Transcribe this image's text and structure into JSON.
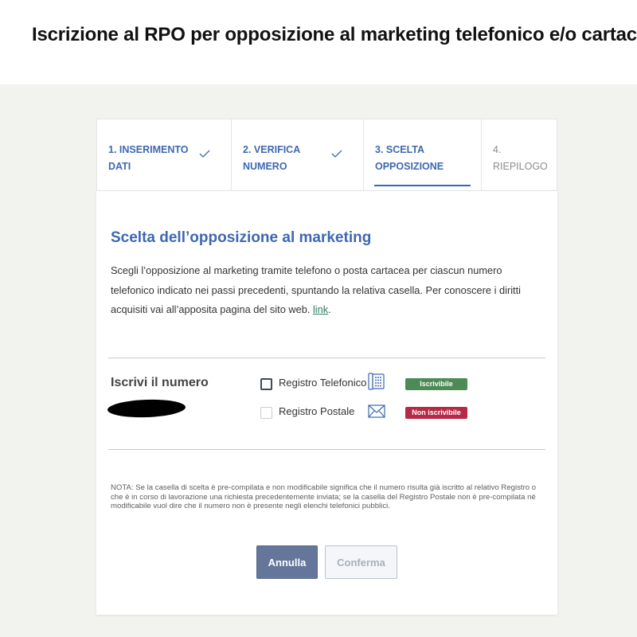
{
  "page": {
    "title": "Iscrizione al RPO per opposizione al marketing telefonico e/o cartaceo"
  },
  "stepper": {
    "steps": [
      {
        "label": "1. INSERIMENTO DATI",
        "state": "completed"
      },
      {
        "label": "2. VERIFICA NUMERO",
        "state": "completed"
      },
      {
        "label": "3. SCELTA OPPOSIZIONE",
        "state": "active"
      },
      {
        "label": "4. RIEPILOGO",
        "state": "upcoming"
      }
    ]
  },
  "content": {
    "section_title": "Scelta dell’opposizione al marketing",
    "intro_text": "Scegli l’opposizione al marketing tramite telefono o posta cartacea per ciascun numero telefonico indicato nei passi precedenti, spuntando la relativa casella. Per conoscere i diritti acquisiti vai all’apposita pagina del sito web.",
    "intro_link": "link",
    "row_label": "Iscrivi il numero",
    "options": [
      {
        "label": "Registro Telefonico",
        "icon": "telephone-keypad-icon",
        "status": "Iscrivibile",
        "status_color": "#4c8a56",
        "checked": false,
        "enabled": true
      },
      {
        "label": "Registro Postale",
        "icon": "envelope-icon",
        "status": "Non iscrivibile",
        "status_color": "#b62a47",
        "checked": false,
        "enabled": false
      }
    ],
    "note": "NOTA: Se la casella di scelta è pre-compilata e non modificabile significa che il numero risulta già iscritto al relativo Registro o che è in corso di lavorazione una richiesta precedentemente inviata; se la casella del Registro Postale non è pre-compilata né modificabile vuol dire che il numero non è presente negli elenchi telefonici pubblici."
  },
  "actions": {
    "cancel_label": "Annulla",
    "confirm_label": "Conferma"
  },
  "colors": {
    "accent": "#3d68b0",
    "cancel_button": "#64769a"
  }
}
